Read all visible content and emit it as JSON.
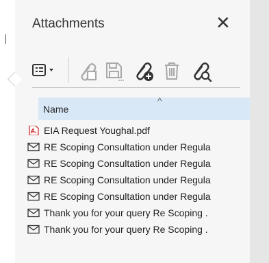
{
  "panel": {
    "title": "Attachments",
    "close_glyph": "✕"
  },
  "toolbar": {
    "buttons": [
      {
        "icon": "view-options-icon",
        "state": "enabled"
      },
      {
        "icon": "open-attachment-icon",
        "state": "disabled"
      },
      {
        "icon": "save-attachment-icon",
        "state": "disabled"
      },
      {
        "icon": "add-attachment-icon",
        "state": "enabled"
      },
      {
        "icon": "delete-attachment-icon",
        "state": "disabled"
      },
      {
        "icon": "search-attachment-icon",
        "state": "enabled"
      }
    ]
  },
  "list": {
    "header": "Name",
    "sort_glyph": "^",
    "items": [
      {
        "icon": "pdf-icon",
        "label": "EIA  Request Youghal.pdf"
      },
      {
        "icon": "email-icon",
        "label": "RE Scoping Consultation under Regula"
      },
      {
        "icon": "email-icon",
        "label": "RE Scoping Consultation under Regula"
      },
      {
        "icon": "email-icon",
        "label": "RE Scoping Consultation under Regula"
      },
      {
        "icon": "email-icon",
        "label": "RE Scoping Consultation under Regula"
      },
      {
        "icon": "email-icon",
        "label": "Thank you for your query Re Scoping ."
      },
      {
        "icon": "email-icon",
        "label": "Thank you for your query Re Scoping ."
      }
    ]
  },
  "colors": {
    "header_bg": "#d9e8f6",
    "pdf_red": "#d32f2f",
    "disabled_gray": "#a9a9a9",
    "enabled_dark": "#333333"
  }
}
